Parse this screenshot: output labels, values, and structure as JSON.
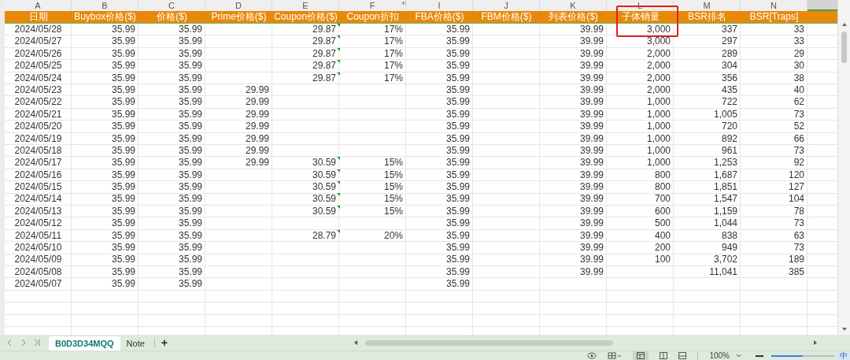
{
  "column_letters": [
    "A",
    "B",
    "C",
    "D",
    "E",
    "F",
    "I",
    "J",
    "K",
    "L",
    "M",
    "N"
  ],
  "columns": [
    {
      "label": "日期",
      "boxed": false
    },
    {
      "label": "Buybox价格($)",
      "boxed": false
    },
    {
      "label": "价格($)",
      "boxed": false
    },
    {
      "label": "Prime价格($)",
      "boxed": false
    },
    {
      "label": "Coupon价格($)",
      "boxed": false
    },
    {
      "label": "Coupon折扣",
      "boxed": false
    },
    {
      "label": "FBA价格($)",
      "boxed": false
    },
    {
      "label": "FBM价格($)",
      "boxed": false
    },
    {
      "label": "列表价格($)",
      "boxed": false
    },
    {
      "label": "子体销量",
      "boxed": true
    },
    {
      "label": "BSR排名",
      "boxed": false
    },
    {
      "label": "BSR[Traps]",
      "boxed": false
    }
  ],
  "rows": [
    {
      "cells": [
        "2024/05/28",
        "35.99",
        "35.99",
        null,
        "29.87",
        "17%",
        "35.99",
        null,
        "39.99",
        "3,000",
        "337",
        "33"
      ],
      "flagged": true
    },
    {
      "cells": [
        "2024/05/27",
        "35.99",
        "35.99",
        null,
        "29.87",
        "17%",
        "35.99",
        null,
        "39.99",
        "3,000",
        "297",
        "33"
      ],
      "flagged": true
    },
    {
      "cells": [
        "2024/05/26",
        "35.99",
        "35.99",
        null,
        "29.87",
        "17%",
        "35.99",
        null,
        "39.99",
        "2,000",
        "289",
        "29"
      ],
      "flagged": true
    },
    {
      "cells": [
        "2024/05/25",
        "35.99",
        "35.99",
        null,
        "29.87",
        "17%",
        "35.99",
        null,
        "39.99",
        "2,000",
        "304",
        "30"
      ],
      "flagged": true
    },
    {
      "cells": [
        "2024/05/24",
        "35.99",
        "35.99",
        null,
        "29.87",
        "17%",
        "35.99",
        null,
        "39.99",
        "2,000",
        "356",
        "38"
      ],
      "flagged": true
    },
    {
      "cells": [
        "2024/05/23",
        "35.99",
        "35.99",
        "29.99",
        null,
        null,
        "35.99",
        null,
        "39.99",
        "2,000",
        "435",
        "40"
      ],
      "flagged": false
    },
    {
      "cells": [
        "2024/05/22",
        "35.99",
        "35.99",
        "29.99",
        null,
        null,
        "35.99",
        null,
        "39.99",
        "1,000",
        "722",
        "62"
      ],
      "flagged": false
    },
    {
      "cells": [
        "2024/05/21",
        "35.99",
        "35.99",
        "29.99",
        null,
        null,
        "35.99",
        null,
        "39.99",
        "1,000",
        "1,005",
        "73"
      ],
      "flagged": false
    },
    {
      "cells": [
        "2024/05/20",
        "35.99",
        "35.99",
        "29.99",
        null,
        null,
        "35.99",
        null,
        "39.99",
        "1,000",
        "720",
        "52"
      ],
      "flagged": false
    },
    {
      "cells": [
        "2024/05/19",
        "35.99",
        "35.99",
        "29.99",
        null,
        null,
        "35.99",
        null,
        "39.99",
        "1,000",
        "892",
        "66"
      ],
      "flagged": false
    },
    {
      "cells": [
        "2024/05/18",
        "35.99",
        "35.99",
        "29.99",
        null,
        null,
        "35.99",
        null,
        "39.99",
        "1,000",
        "961",
        "73"
      ],
      "flagged": false
    },
    {
      "cells": [
        "2024/05/17",
        "35.99",
        "35.99",
        "29.99",
        "30.59",
        "15%",
        "35.99",
        null,
        "39.99",
        "1,000",
        "1,253",
        "92"
      ],
      "flagged": true
    },
    {
      "cells": [
        "2024/05/16",
        "35.99",
        "35.99",
        null,
        "30.59",
        "15%",
        "35.99",
        null,
        "39.99",
        "800",
        "1,687",
        "120"
      ],
      "flagged": true
    },
    {
      "cells": [
        "2024/05/15",
        "35.99",
        "35.99",
        null,
        "30.59",
        "15%",
        "35.99",
        null,
        "39.99",
        "800",
        "1,851",
        "127"
      ],
      "flagged": true
    },
    {
      "cells": [
        "2024/05/14",
        "35.99",
        "35.99",
        null,
        "30.59",
        "15%",
        "35.99",
        null,
        "39.99",
        "700",
        "1,547",
        "104"
      ],
      "flagged": true
    },
    {
      "cells": [
        "2024/05/13",
        "35.99",
        "35.99",
        null,
        "30.59",
        "15%",
        "35.99",
        null,
        "39.99",
        "600",
        "1,159",
        "78"
      ],
      "flagged": true
    },
    {
      "cells": [
        "2024/05/12",
        "35.99",
        "35.99",
        null,
        null,
        null,
        "35.99",
        null,
        "39.99",
        "500",
        "1,044",
        "73"
      ],
      "flagged": false
    },
    {
      "cells": [
        "2024/05/11",
        "35.99",
        "35.99",
        null,
        "28.79",
        "20%",
        "35.99",
        null,
        "39.99",
        "400",
        "838",
        "63"
      ],
      "flagged": true
    },
    {
      "cells": [
        "2024/05/10",
        "35.99",
        "35.99",
        null,
        null,
        null,
        "35.99",
        null,
        "39.99",
        "200",
        "949",
        "73"
      ],
      "flagged": false
    },
    {
      "cells": [
        "2024/05/09",
        "35.99",
        "35.99",
        null,
        null,
        null,
        "35.99",
        null,
        "39.99",
        "100",
        "3,702",
        "189"
      ],
      "flagged": false
    },
    {
      "cells": [
        "2024/05/08",
        "35.99",
        "35.99",
        null,
        null,
        null,
        "35.99",
        null,
        "39.99",
        null,
        "11,041",
        "385"
      ],
      "flagged": false
    },
    {
      "cells": [
        "2024/05/07",
        "35.99",
        "35.99",
        null,
        null,
        null,
        "35.99",
        null,
        null,
        null,
        null,
        null
      ],
      "flagged": false
    }
  ],
  "sheet_tabs": [
    {
      "label": "B0D3D34MQQ",
      "selected": true
    },
    {
      "label": "Note",
      "selected": false
    }
  ],
  "add_tab": "+",
  "status_bar": {
    "zoom": "100%",
    "zoom_slider": {
      "level": 0.5
    },
    "ime": "中"
  }
}
